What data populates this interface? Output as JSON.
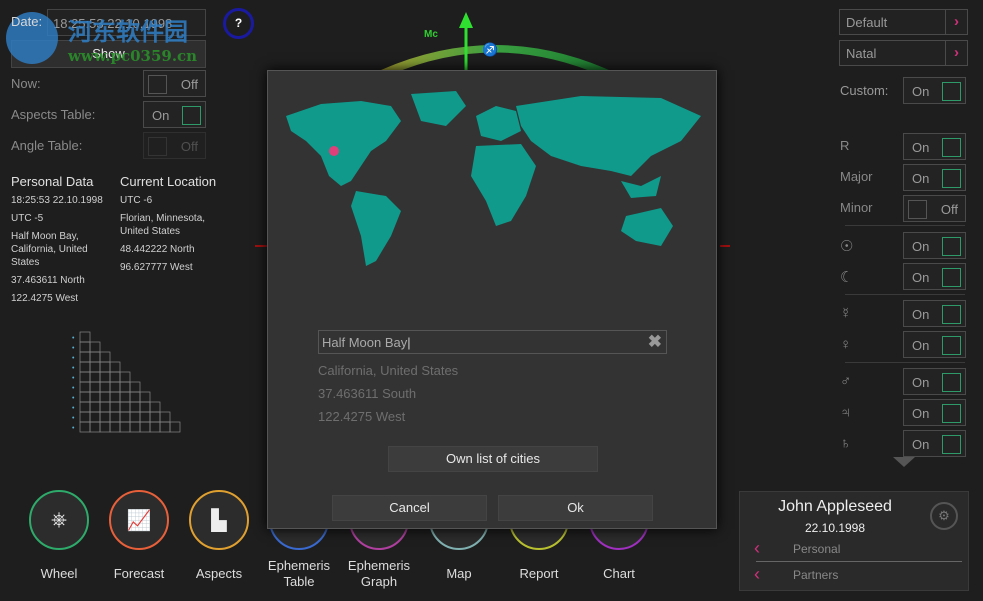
{
  "left": {
    "date_label": "Date:",
    "date_value": "18:25:53 22.10.1998",
    "show_label": "Show",
    "help_label": "?",
    "now": {
      "label": "Now:",
      "state": "Off"
    },
    "aspects_table": {
      "label": "Aspects Table:",
      "state": "On"
    },
    "angle_table": {
      "label": "Angle Table:",
      "state": "Off"
    },
    "personal": {
      "title": "Personal Data",
      "lines": [
        "18:25:53 22.10.1998",
        "UTC -5",
        "Half Moon Bay, California, United States",
        "37.463611 North",
        "122.4275 West"
      ]
    },
    "current": {
      "title": "Current Location",
      "lines": [
        "UTC -6",
        "Florian, Minnesota, United States",
        "48.442222 North",
        "96.627777 West"
      ]
    }
  },
  "wheel": {
    "mc_label": "Mc",
    "sign_glyph": "♐"
  },
  "watermark": {
    "text": "河东软件园",
    "url": "www.pc0359.cn"
  },
  "dialog": {
    "search_value": "Half Moon Bay",
    "region": "California, United States",
    "lat": "37.463611 South",
    "lon": "122.4275 West",
    "own_list": "Own list of cities",
    "cancel": "Cancel",
    "ok": "Ok",
    "map_color": "#0f9a8c",
    "marker_color": "#e0407a"
  },
  "right": {
    "preset": "Default",
    "chart_type": "Natal",
    "custom": {
      "label": "Custom:",
      "state": "On"
    },
    "toggles": [
      {
        "label": "R",
        "state": "On"
      },
      {
        "label": "Major",
        "state": "On"
      },
      {
        "label": "Minor",
        "state": "Off"
      },
      {
        "label": "☉",
        "state": "On"
      },
      {
        "label": "☾",
        "state": "On"
      },
      {
        "label": "☿",
        "state": "On"
      },
      {
        "label": "♀",
        "state": "On"
      },
      {
        "label": "♂",
        "state": "On"
      },
      {
        "label": "♃",
        "state": "On"
      },
      {
        "label": "♄",
        "state": "On"
      }
    ]
  },
  "nav": [
    {
      "label": "Wheel",
      "icon": "wheel-icon",
      "color": "#2eaa6a",
      "glyph": "⎈"
    },
    {
      "label": "Forecast",
      "icon": "trend-chart-icon",
      "color": "#e8603a",
      "glyph": "📈"
    },
    {
      "label": "Aspects",
      "icon": "aspects-grid-icon",
      "color": "#e0a030",
      "glyph": "▙"
    },
    {
      "label": "Ephemeris Table",
      "icon": "table-icon",
      "color": "#3a6ad0",
      "glyph": ""
    },
    {
      "label": "Ephemeris Graph",
      "icon": "graph-icon",
      "color": "#b040a0",
      "glyph": ""
    },
    {
      "label": "Map",
      "icon": "map-icon",
      "color": "#80b0b0",
      "glyph": ""
    },
    {
      "label": "Report",
      "icon": "report-icon",
      "color": "#b8c030",
      "glyph": ""
    },
    {
      "label": "Chart",
      "icon": "chart-icon",
      "color": "#a030c0",
      "glyph": ""
    }
  ],
  "profile": {
    "name": "John Appleseed",
    "date": "22.10.1998",
    "personal": "Personal",
    "partners": "Partners"
  }
}
